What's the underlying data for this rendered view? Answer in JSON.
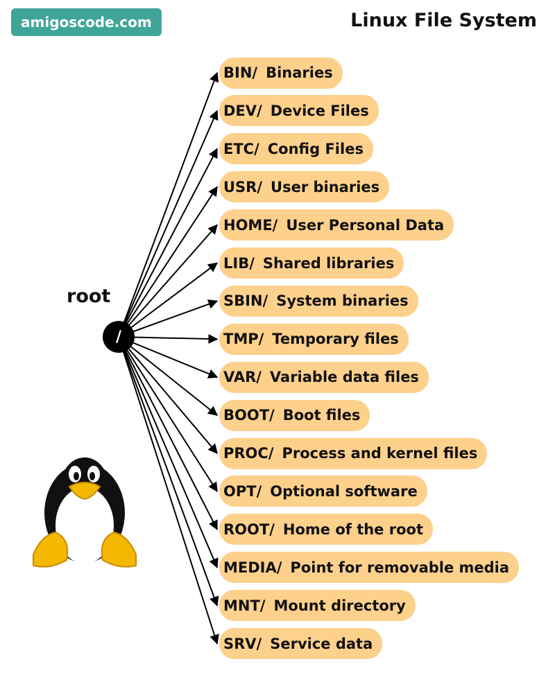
{
  "brand": "amigoscode.com",
  "title": "Linux File System",
  "root": {
    "label": "root",
    "symbol": "/"
  },
  "directories": [
    {
      "name": "BIN/",
      "description": "Binaries"
    },
    {
      "name": "DEV/",
      "description": "Device Files"
    },
    {
      "name": "ETC/",
      "description": "Config Files"
    },
    {
      "name": "USR/",
      "description": "User binaries"
    },
    {
      "name": "HOME/",
      "description": "User Personal Data"
    },
    {
      "name": "LIB/",
      "description": "Shared libraries"
    },
    {
      "name": "SBIN/",
      "description": "System binaries"
    },
    {
      "name": "TMP/",
      "description": "Temporary files"
    },
    {
      "name": "VAR/",
      "description": "Variable data files"
    },
    {
      "name": "BOOT/",
      "description": "Boot files"
    },
    {
      "name": "PROC/",
      "description": "Process and kernel files"
    },
    {
      "name": "OPT/",
      "description": "Optional software"
    },
    {
      "name": "ROOT/",
      "description": "Home of the root"
    },
    {
      "name": "MEDIA/",
      "description": "Point for removable media"
    },
    {
      "name": "MNT/",
      "description": "Mount directory"
    },
    {
      "name": "SRV/",
      "description": "Service data"
    }
  ],
  "colors": {
    "brand_bg": "#3fa599",
    "node_fill": "#fdd08c",
    "root_fill": "#000000",
    "edge": "#000000"
  },
  "icons": {
    "mascot": "tux-penguin-icon"
  }
}
